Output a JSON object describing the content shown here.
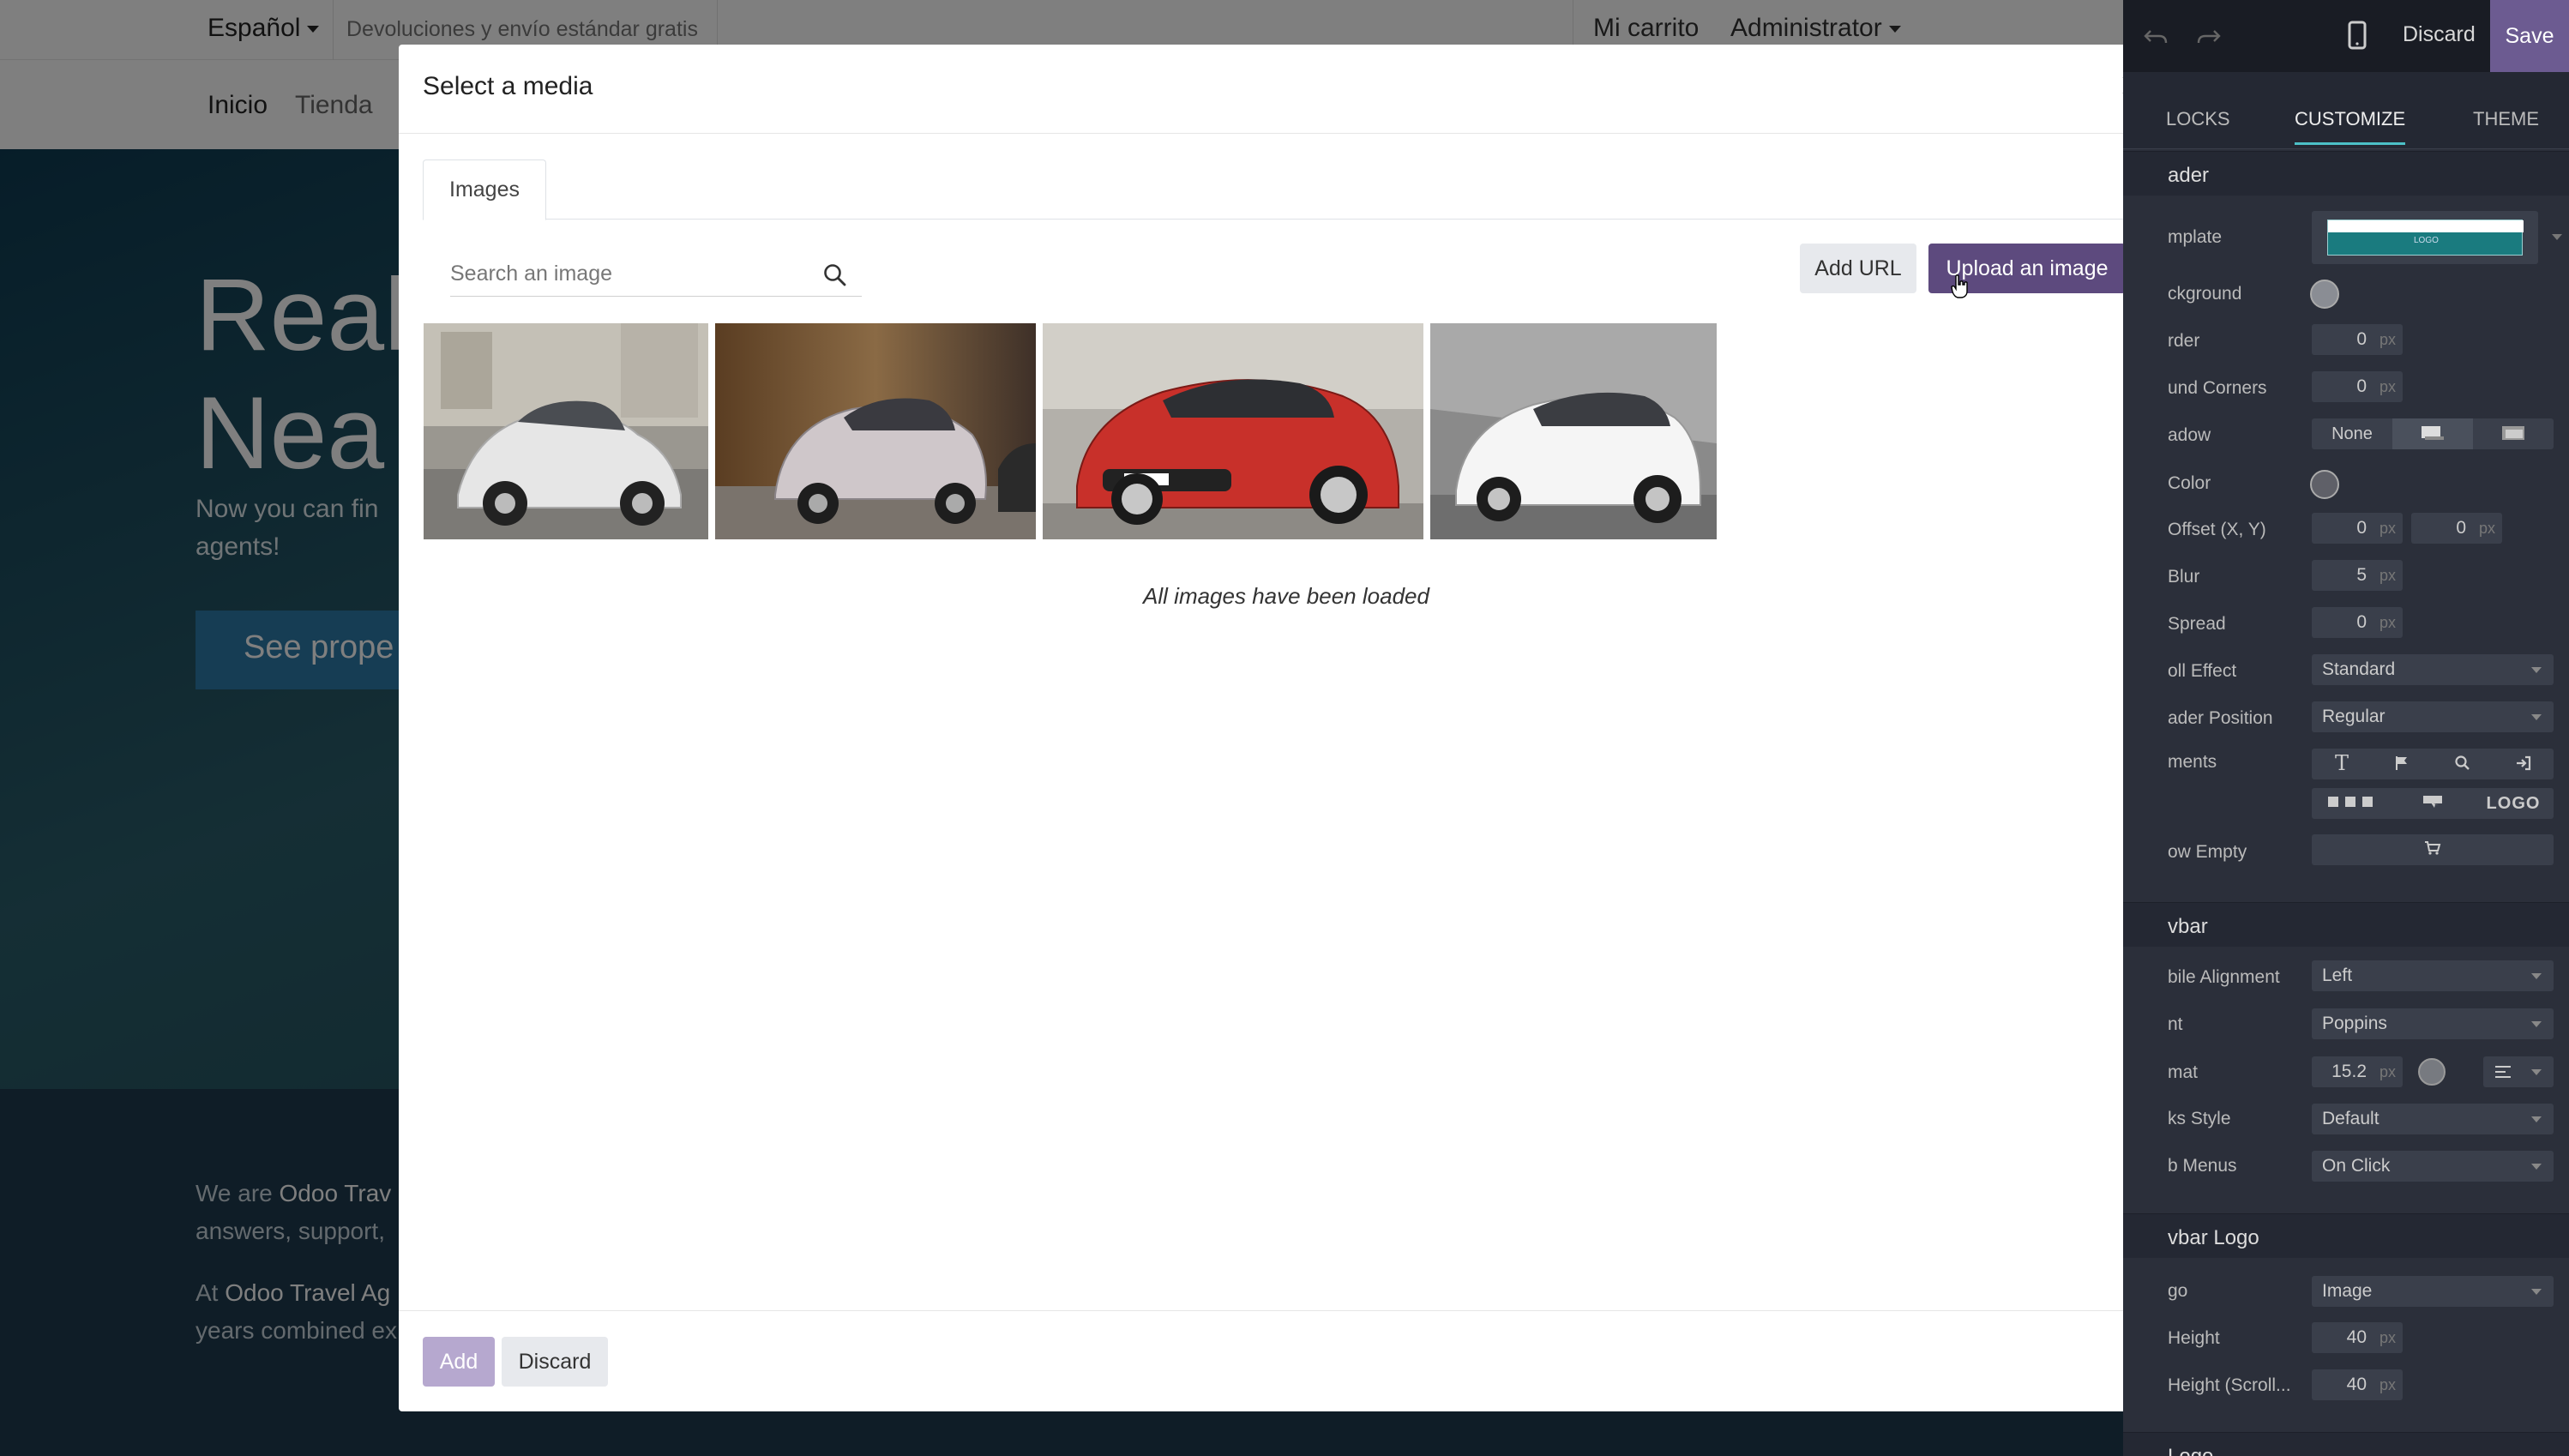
{
  "website": {
    "topbar": {
      "language": "Español",
      "promo": "Devoluciones y envío estándar gratis",
      "cart": "Mi carrito",
      "user": "Administrator"
    },
    "nav": [
      "Inicio",
      "Tienda"
    ],
    "hero": {
      "title_line1": "Real",
      "title_line2": "Nea",
      "subtitle_line1": "Now you can fin",
      "subtitle_line2": "agents!",
      "button": "See prope"
    },
    "about": {
      "p1_prefix": "We are ",
      "p1_brand": "Odoo Trav",
      "p1_line2": "answers, support,",
      "p2_prefix": "At ",
      "p2_brand": "Odoo Travel Ag",
      "p2_line2": "years combined ex"
    }
  },
  "modal": {
    "title": "Select a media",
    "close_symbol": "×",
    "tabs": [
      "Images"
    ],
    "search_placeholder": "Search an image",
    "add_url": "Add URL",
    "upload": "Upload an image",
    "images": [
      {
        "name": "white-fiat-500-street",
        "color": "#dcdcdc"
      },
      {
        "name": "grey-fiat-500-motion",
        "color": "#c8c3c6"
      },
      {
        "name": "red-fiat-500-front",
        "color": "#c3312a"
      },
      {
        "name": "white-fiat-500-side",
        "color": "#f2f2f2"
      }
    ],
    "status": "All images have been loaded",
    "footer": {
      "add": "Add",
      "discard": "Discard"
    }
  },
  "editor": {
    "discard": "Discard",
    "save": "Save",
    "tabs": [
      "LOCKS",
      "CUSTOMIZE",
      "THEME"
    ],
    "header_section": "ader",
    "rows": {
      "template": "mplate",
      "background": "ckground",
      "border": "rder",
      "round_corners": "und Corners",
      "shadow": "adow",
      "color": "Color",
      "offset": "Offset (X, Y)",
      "blur": "Blur",
      "spread": "Spread",
      "scroll_effect": "oll Effect",
      "header_position": "ader Position",
      "components": "ments",
      "show_empty": "ow Empty"
    },
    "values": {
      "border": "0",
      "round_corners": "0",
      "shadow_none": "None",
      "offset_x": "0",
      "offset_y": "0",
      "blur": "5",
      "spread": "0",
      "scroll_effect": "Standard",
      "header_position": "Regular",
      "logo_label": "LOGO",
      "unit": "px"
    },
    "navbar_section": "vbar",
    "navbar_rows": {
      "mobile_alignment": "bile Alignment",
      "font": "nt",
      "format": "mat",
      "links_style": "ks Style",
      "sub_menus": "b Menus"
    },
    "navbar_values": {
      "mobile_alignment": "Left",
      "font": "Poppins",
      "format": "15.2",
      "links_style": "Default",
      "sub_menus": "On Click"
    },
    "navbar_logo_section": "vbar Logo",
    "logo_rows": {
      "logo": "go",
      "height": "Height",
      "height_scrolled": "Height (Scroll..."
    },
    "logo_values": {
      "logo": "Image",
      "height": "40",
      "height_scrolled": "40"
    },
    "logo_section": "Logo"
  }
}
